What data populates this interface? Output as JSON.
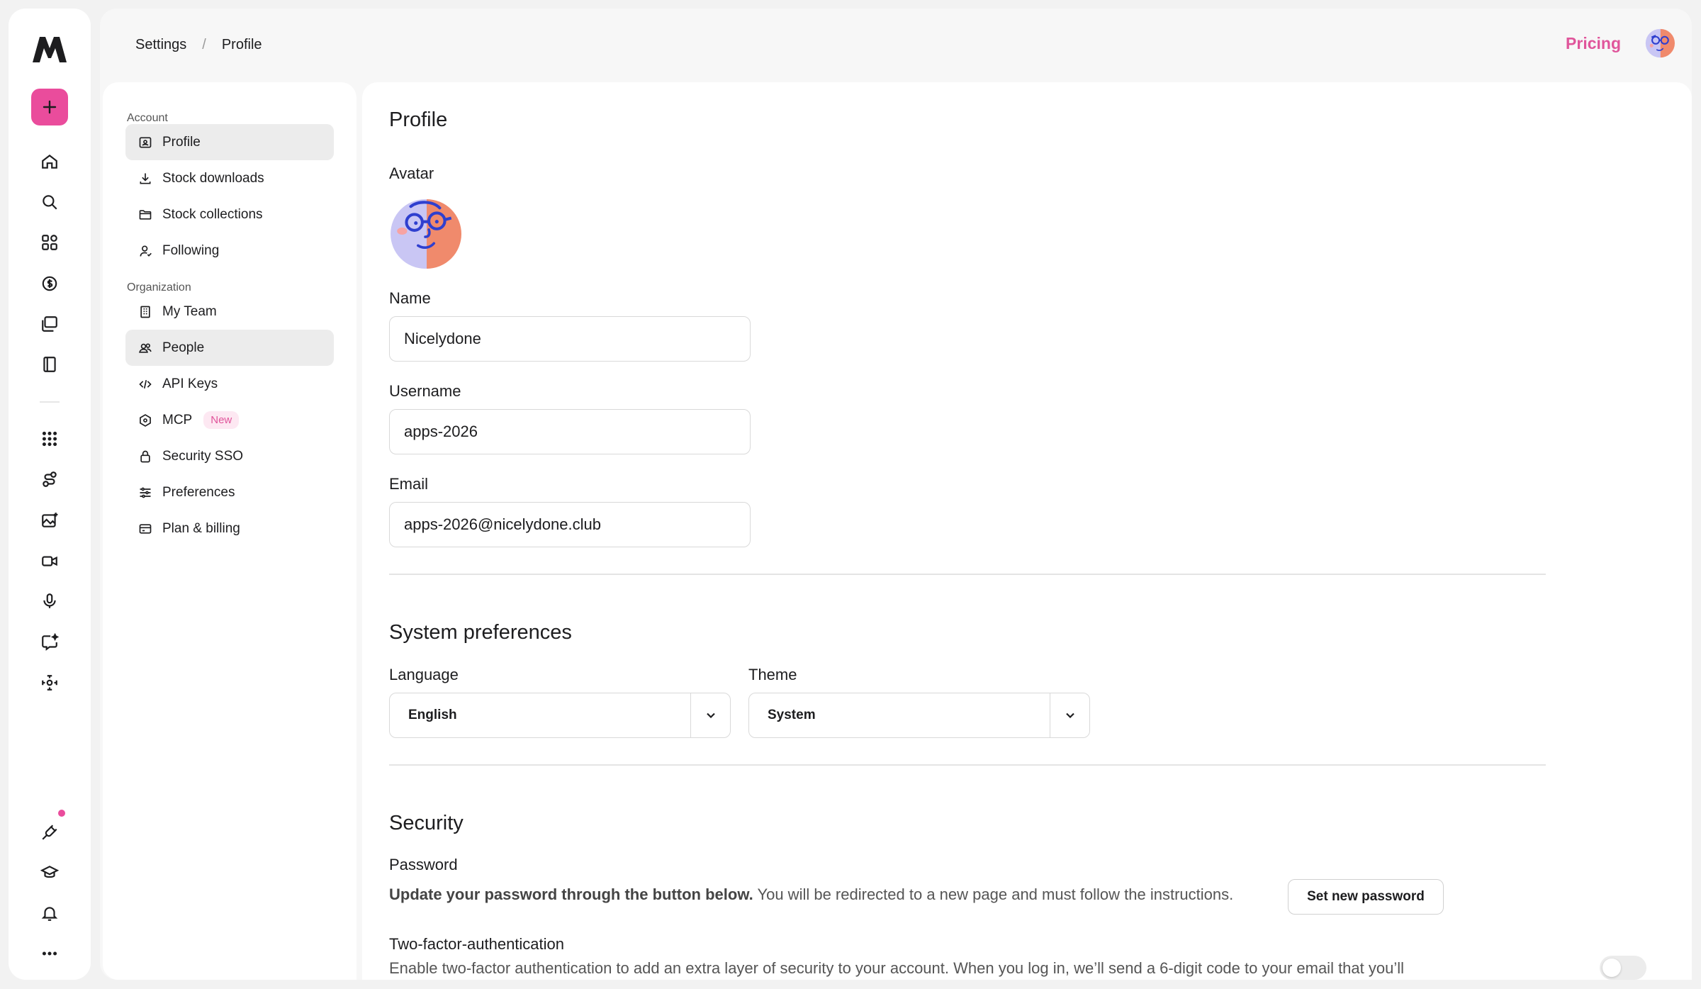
{
  "rail": {
    "icons": [
      "logo-icon",
      "plus-icon",
      "home-icon",
      "search-icon",
      "apps-grid-icon",
      "stock-icon",
      "collections-icon",
      "book-icon",
      "dots-grid-icon",
      "connect-icon",
      "image-gen-icon",
      "video-icon",
      "microphone-icon",
      "chat-spark-icon",
      "drone-icon",
      "plug-icon",
      "graduation-cap-icon",
      "bell-icon",
      "more-icon"
    ],
    "accent": "#ea4c9c"
  },
  "header": {
    "breadcrumb": [
      "Settings",
      "/",
      "Profile"
    ],
    "pricing_label": "Pricing"
  },
  "subnav": {
    "account_label": "Account",
    "account_items": [
      {
        "label": "Profile",
        "icon": "profile-card-icon",
        "active": true
      },
      {
        "label": "Stock downloads",
        "icon": "download-icon"
      },
      {
        "label": "Stock collections",
        "icon": "folder-icon"
      },
      {
        "label": "Following",
        "icon": "user-follow-icon"
      }
    ],
    "org_label": "Organization",
    "org_items": [
      {
        "label": "My Team",
        "icon": "building-icon"
      },
      {
        "label": "People",
        "icon": "people-icon",
        "hover": true
      },
      {
        "label": "API Keys",
        "icon": "code-icon"
      },
      {
        "label": "MCP",
        "icon": "hexagon-icon",
        "badge": "New"
      },
      {
        "label": "Security SSO",
        "icon": "lock-icon"
      },
      {
        "label": "Preferences",
        "icon": "sliders-icon"
      },
      {
        "label": "Plan & billing",
        "icon": "card-icon"
      }
    ]
  },
  "profile": {
    "title": "Profile",
    "avatar_label": "Avatar",
    "name_label": "Name",
    "name_value": "Nicelydone",
    "username_label": "Username",
    "username_value": "apps-2026",
    "email_label": "Email",
    "email_value": "apps-2026@nicelydone.club"
  },
  "system": {
    "title": "System preferences",
    "language_label": "Language",
    "language_value": "English",
    "theme_label": "Theme",
    "theme_value": "System"
  },
  "security": {
    "title": "Security",
    "password_label": "Password",
    "password_bold": "Update your password through the button below.",
    "password_rest": " You will be redirected to a new page and must follow the instructions.",
    "password_button": "Set new password",
    "tfa_label": "Two-factor-authentication",
    "tfa_text": "Enable two-factor authentication to add an extra layer of security to your account. When you log in, we’ll send a 6-digit code to your email that you’ll",
    "tfa_enabled": false
  }
}
